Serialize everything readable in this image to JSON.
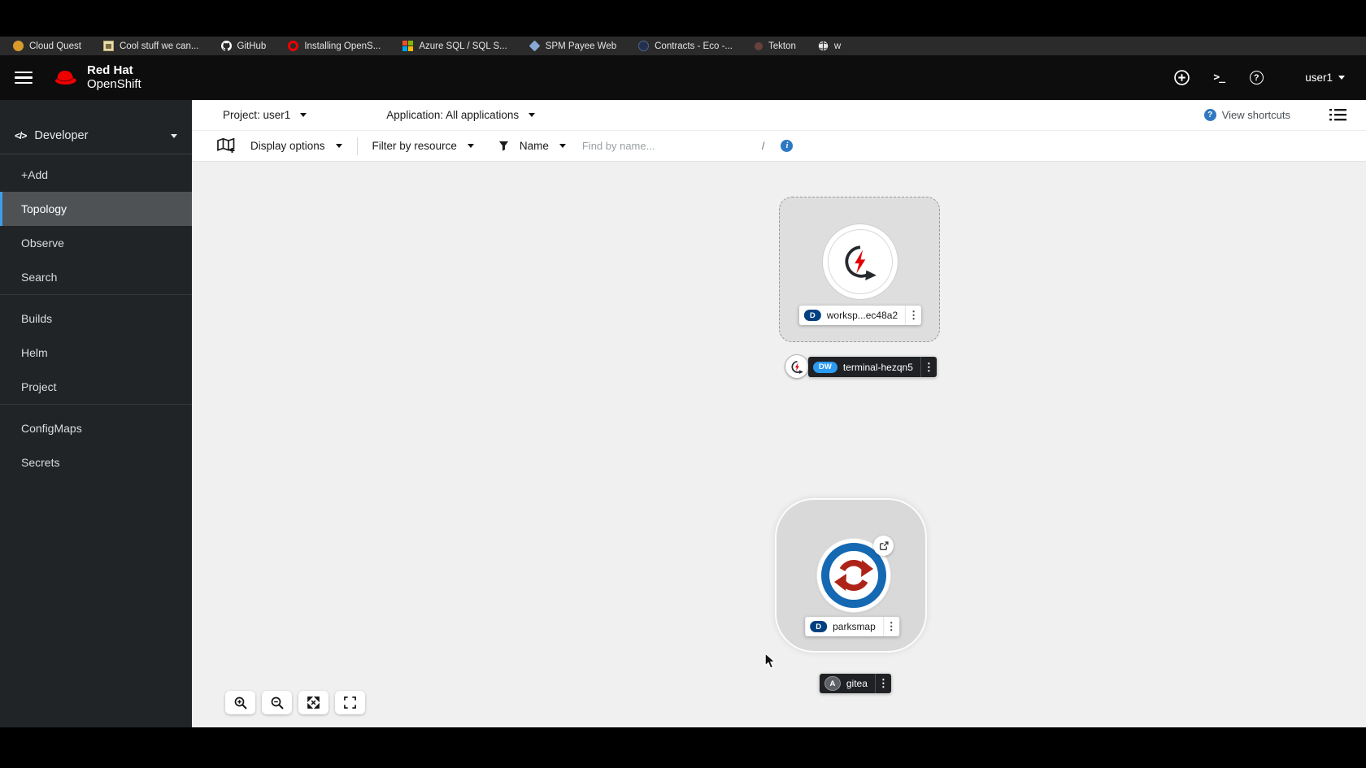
{
  "icons": {
    "developer_glyph": "</>",
    "terminal_glyph": ">_",
    "help_glyph": "?",
    "add_glyph": "+",
    "question_glyph": "?",
    "info_glyph": "i",
    "kebab_glyph": "⋮"
  },
  "colors": {
    "redhat_red": "#ee0000",
    "nav_active_border": "#3f9ee8",
    "badge_deployment": "#004080",
    "badge_devworkspace": "#2b9af3",
    "badge_application": "#5d6166",
    "parksmap_ring": "#1569b3"
  },
  "bookmarks": [
    "Cloud Quest",
    "Cool stuff we can...",
    "GitHub",
    "Installing OpenS...",
    "Azure SQL / SQL S...",
    "SPM Payee Web",
    "Contracts - Eco -...",
    "Tekton",
    "w"
  ],
  "masthead": {
    "brand_top": "Red Hat",
    "brand_bottom": "OpenShift",
    "user": "user1"
  },
  "sidebar": {
    "perspective": "Developer",
    "groups": [
      {
        "items": [
          "+Add",
          "Topology",
          "Observe",
          "Search"
        ]
      },
      {
        "items": [
          "Builds",
          "Helm",
          "Project"
        ]
      },
      {
        "items": [
          "ConfigMaps",
          "Secrets"
        ]
      }
    ],
    "active_item": "Topology"
  },
  "context_bar": {
    "project": "Project: user1",
    "application": "Application: All applications",
    "view_shortcuts": "View shortcuts"
  },
  "filter_bar": {
    "display_options": "Display options",
    "filter_by_resource": "Filter by resource",
    "name_filter": "Name",
    "find_placeholder": "Find by name...",
    "shortcut_hint": "/"
  },
  "topology": {
    "workspace_node": {
      "badge": "D",
      "label": "worksp...ec48a2"
    },
    "terminal_node": {
      "badge": "DW",
      "label": "terminal-hezqn5"
    },
    "parksmap_node": {
      "badge": "D",
      "label": "parksmap"
    },
    "gitea_node": {
      "badge": "A",
      "label": "gitea"
    }
  },
  "zoom_controls": [
    "zoom-in",
    "zoom-out",
    "fit-to-screen",
    "reset-view"
  ]
}
